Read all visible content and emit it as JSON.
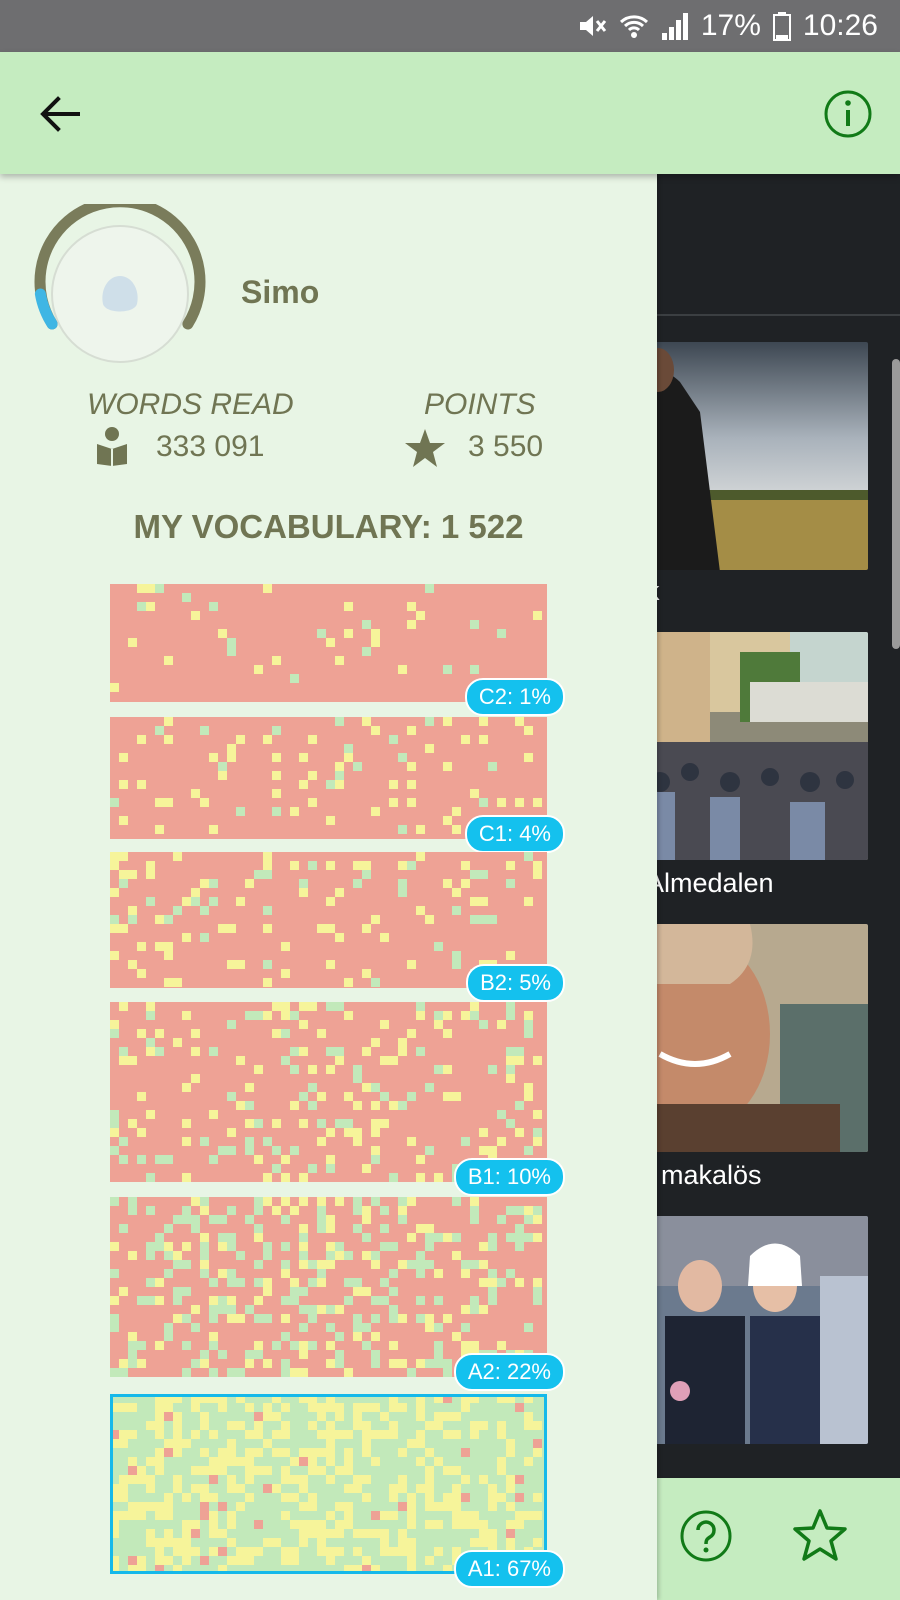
{
  "status_bar": {
    "battery": "17%",
    "time": "10:26",
    "icons": [
      "mute-icon",
      "wifi-icon",
      "signal-icon",
      "battery-icon"
    ]
  },
  "app_bar": {
    "back_icon": "arrow-left-icon",
    "info_icon": "info-circle-icon"
  },
  "profile": {
    "name": "Simo",
    "words_read_label": "WORDS READ",
    "words_read": "333 091",
    "points_label": "POINTS",
    "points": "3 550",
    "vocabulary_label": "MY VOCABULARY: 1 522"
  },
  "levels": [
    {
      "id": "c2",
      "label": "C2: 1%",
      "percent": 1
    },
    {
      "id": "c1",
      "label": "C1: 4%",
      "percent": 4
    },
    {
      "id": "b2",
      "label": "B2: 5%",
      "percent": 5
    },
    {
      "id": "b1",
      "label": "B1: 10%",
      "percent": 10
    },
    {
      "id": "a2",
      "label": "A2: 22%",
      "percent": 22
    },
    {
      "id": "a1",
      "label": "A1: 67%",
      "percent": 67,
      "selected": true
    }
  ],
  "feed": {
    "captions": [
      "k",
      "Almedalen",
      ", makalös"
    ]
  },
  "bottom_bar": {
    "help_icon": "help-circle-icon",
    "favorites_icon": "star-outline-icon"
  },
  "colors": {
    "unknown": "#eea295",
    "learning": "#f6f49a",
    "known": "#c2e9ba",
    "accent": "#14c1ee",
    "olive": "#707553"
  }
}
